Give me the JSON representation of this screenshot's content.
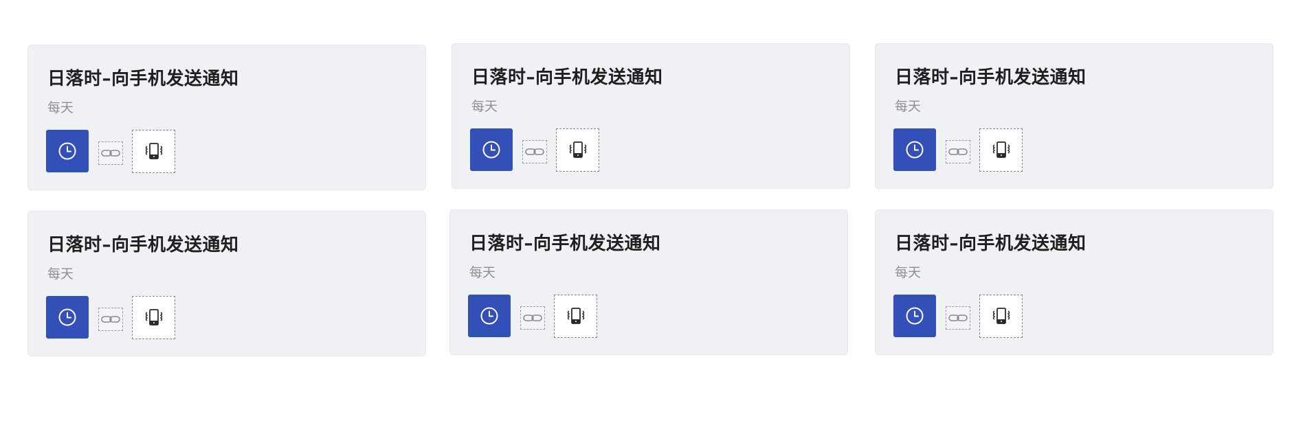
{
  "automations": [
    {
      "title": "日落时–向手机发送通知",
      "schedule": "每天",
      "trigger_icon": "clock-icon",
      "link_icon": "link-icon",
      "action_icon": "phone-vibrate-icon"
    },
    {
      "title": "日落时–向手机发送通知",
      "schedule": "每天",
      "trigger_icon": "clock-icon",
      "link_icon": "link-icon",
      "action_icon": "phone-vibrate-icon"
    },
    {
      "title": "日落时–向手机发送通知",
      "schedule": "每天",
      "trigger_icon": "clock-icon",
      "link_icon": "link-icon",
      "action_icon": "phone-vibrate-icon"
    },
    {
      "title": "日落时–向手机发送通知",
      "schedule": "每天",
      "trigger_icon": "clock-icon",
      "link_icon": "link-icon",
      "action_icon": "phone-vibrate-icon"
    },
    {
      "title": "日落时–向手机发送通知",
      "schedule": "每天",
      "trigger_icon": "clock-icon",
      "link_icon": "link-icon",
      "action_icon": "phone-vibrate-icon"
    },
    {
      "title": "日落时–向手机发送通知",
      "schedule": "每天",
      "trigger_icon": "clock-icon",
      "link_icon": "link-icon",
      "action_icon": "phone-vibrate-icon"
    }
  ],
  "colors": {
    "card_background": "#f0f1f5",
    "trigger_background": "#3350b8",
    "title_text": "#1f1f1f",
    "subtitle_text": "#8e8e93"
  }
}
